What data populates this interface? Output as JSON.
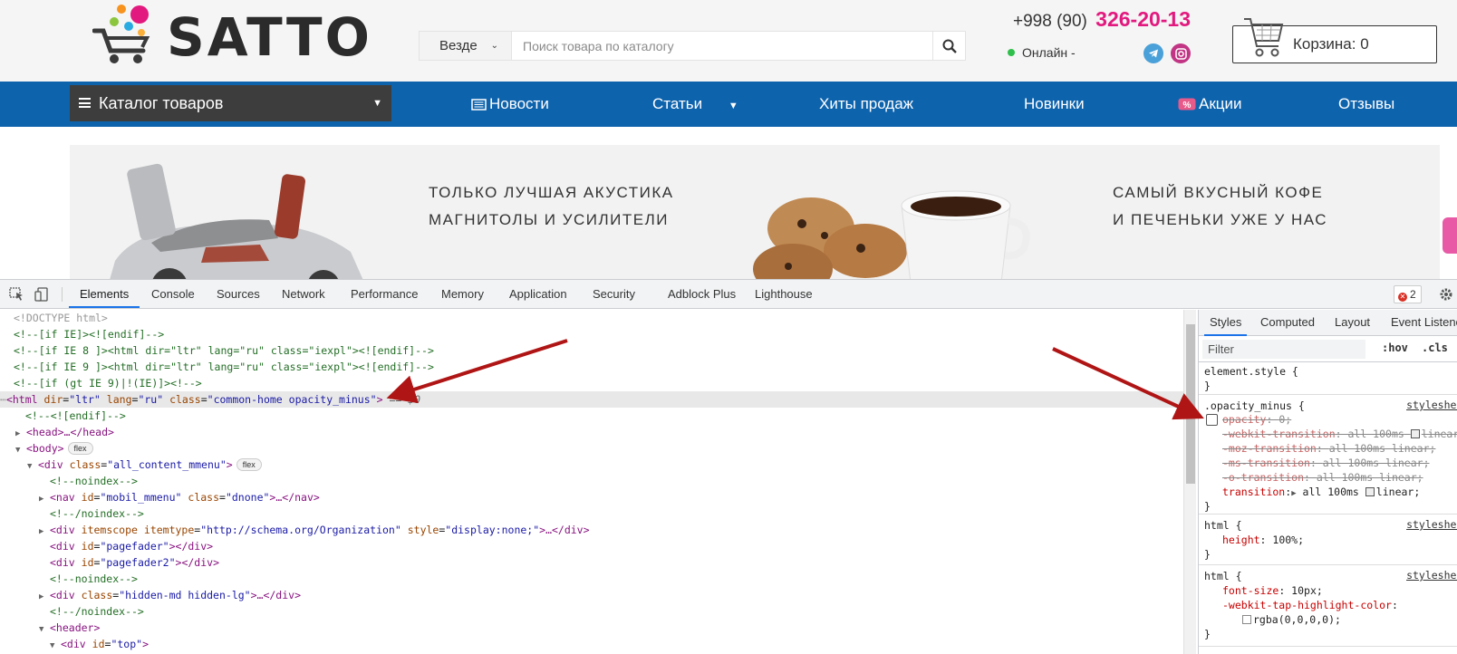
{
  "site": {
    "logo_text": "SATTO",
    "search_scope": "Везде",
    "search_placeholder": "Поиск товара по каталогу",
    "phone_prefix": "+998 (90)",
    "phone_main": "326-20-13",
    "online_label": "Онлайн -",
    "cart_label": "Корзина: 0",
    "catalog_label": "Каталог товаров",
    "nav": [
      "Новости",
      "Статьи",
      "Хиты продаж",
      "Новинки",
      "Акции",
      "Отзывы"
    ],
    "banner_left": [
      "ТОЛЬКО ЛУЧШАЯ АКУСТИКА",
      "МАГНИТОЛЫ И УСИЛИТЕЛИ"
    ],
    "banner_right": [
      "САМЫЙ ВКУСНЫЙ КОФЕ",
      "И ПЕЧЕНЬКИ УЖЕ У НАС"
    ],
    "colors": {
      "nav_bg": "#0e63ad",
      "catalog_bg": "#3d3d3d",
      "phone_accent": "#e2197e",
      "online_dot": "#2ec04a"
    }
  },
  "devtools": {
    "tabs": [
      "Elements",
      "Console",
      "Sources",
      "Network",
      "Performance",
      "Memory",
      "Application",
      "Security",
      "Adblock Plus",
      "Lighthouse"
    ],
    "active_tab": "Elements",
    "error_count": "2",
    "dom": {
      "l0": "<!DOCTYPE html>",
      "l1": "<!--[if IE]><![endif]-->",
      "l2": "<!--[if IE 8 ]><html dir=\"ltr\" lang=\"ru\" class=\"iexpl\"><![endif]-->",
      "l3": "<!--[if IE 9 ]><html dir=\"ltr\" lang=\"ru\" class=\"iexpl\"><![endif]-->",
      "l4": "<!--[if (gt IE 9)|!(IE)]><!-->",
      "html_tag": "html",
      "attr_dir": "dir",
      "val_dir": "\"ltr\"",
      "attr_lang": "lang",
      "val_lang": "\"ru\"",
      "attr_class": "class",
      "val_class": "\"common-home opacity_minus\"",
      "sel_marker": "== $0",
      "l6": "<!--<![endif]-->",
      "head": "<head>…</head>",
      "body": "<body>",
      "flex_badge": "flex",
      "div_all_tag": "<div",
      "div_all_attr": "class",
      "div_all_val": "\"all_content_mmenu\"",
      "noindex_open": "<!--noindex-->",
      "nav_tag": "<nav",
      "nav_attr_id": "id",
      "nav_val_id": "\"mobil_mmenu\"",
      "nav_attr_class": "class",
      "nav_val_class": "\"dnone\"",
      "nav_tail": ">…</nav>",
      "noindex_close": "<!--/noindex-->",
      "div_scope_tag": "<div",
      "div_scope_attr1": "itemscope",
      "div_scope_attr2": "itemtype",
      "div_scope_val2": "\"http://schema.org/Organization\"",
      "div_scope_attr3": "style",
      "div_scope_val3": "\"display:none;\"",
      "div_scope_tail": ">…</div>",
      "pf1_val": "\"pagefader\"",
      "pf2_val": "\"pagefader2\"",
      "hidden_val": "\"hidden-md hidden-lg\"",
      "header": "<header>",
      "top_val": "\"top\""
    },
    "styles_tabs": [
      "Styles",
      "Computed",
      "Layout",
      "Event Listeners"
    ],
    "filter_placeholder": "Filter",
    "hov": ":hov",
    "cls": ".cls",
    "rules": {
      "element_style": "element.style {",
      "close": "}",
      "opacity_selector": ".opacity_minus {",
      "source": "stylesheet_min",
      "opacity_prop": "opacity",
      "opacity_val": "0;",
      "webkit_prop": "-webkit-transition",
      "webkit_val": "all 100ms",
      "webkit_tail": "linear;",
      "moz_prop": "-moz-transition",
      "moz_val": "all 100ms linear;",
      "ms_prop": "-ms-transition",
      "ms_val": "all 100ms linear;",
      "o_prop": "-o-transition",
      "o_val": "all 100ms linear;",
      "trans_prop": "transition",
      "trans_val": "all 100ms",
      "trans_tail": "linear;",
      "html_selector": "html {",
      "height_prop": "height",
      "height_val": "100%;",
      "fs_prop": "font-size",
      "fs_val": "10px;",
      "tap_prop": "-webkit-tap-highlight-color",
      "tap_val": "rgba(0,0,0,0);"
    }
  }
}
